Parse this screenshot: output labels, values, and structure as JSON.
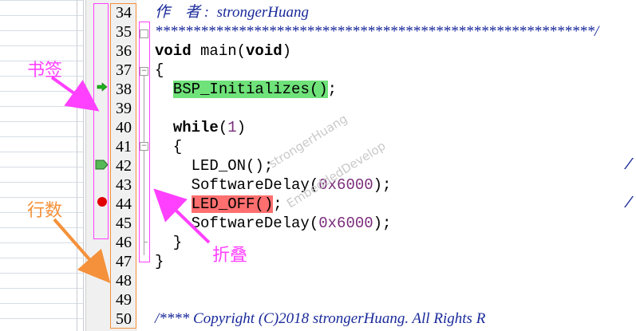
{
  "editor": {
    "line_numbers": [
      "34",
      "35",
      "36",
      "37",
      "38",
      "39",
      "40",
      "41",
      "42",
      "43",
      "44",
      "45",
      "46",
      "47",
      "48",
      "49",
      "50"
    ],
    "lines": [
      {
        "segments": [
          {
            "t": "作    者 :  strongerHuang",
            "c": "comment"
          }
        ]
      },
      {
        "segments": [
          {
            "t": "**********************************************************/",
            "c": "comment"
          }
        ]
      },
      {
        "segments": [
          {
            "t": "void",
            "c": "kw"
          },
          {
            "t": " main("
          },
          {
            "t": "void",
            "c": "kw"
          },
          {
            "t": ")"
          }
        ]
      },
      {
        "segments": [
          {
            "t": "{"
          }
        ]
      },
      {
        "segments": [
          {
            "t": "  "
          },
          {
            "t": "BSP_Initializes()",
            "c": "hl-green"
          },
          {
            "t": ";"
          }
        ]
      },
      {
        "segments": []
      },
      {
        "segments": [
          {
            "t": "  "
          },
          {
            "t": "while",
            "c": "kw"
          },
          {
            "t": "("
          },
          {
            "t": "1",
            "c": "num"
          },
          {
            "t": ")"
          }
        ]
      },
      {
        "segments": [
          {
            "t": "  {"
          }
        ]
      },
      {
        "segments": [
          {
            "t": "    LED_ON();"
          }
        ]
      },
      {
        "segments": [
          {
            "t": "    SoftwareDelay("
          },
          {
            "t": "0x6000",
            "c": "num"
          },
          {
            "t": ");"
          }
        ]
      },
      {
        "segments": [
          {
            "t": "    "
          },
          {
            "t": "LED_OFF()",
            "c": "hl-red"
          },
          {
            "t": ";"
          }
        ]
      },
      {
        "segments": [
          {
            "t": "    SoftwareDelay("
          },
          {
            "t": "0x6000",
            "c": "num"
          },
          {
            "t": ");"
          }
        ]
      },
      {
        "segments": [
          {
            "t": "  }"
          }
        ]
      },
      {
        "segments": [
          {
            "t": "}"
          }
        ]
      },
      {
        "segments": []
      },
      {
        "segments": []
      },
      {
        "segments": [
          {
            "t": "/**** Copyright (C)2018 strongerHuang. All Rights R",
            "c": "comment"
          }
        ]
      }
    ],
    "trailing_comment_marker": "/"
  },
  "annotations": {
    "bookmark_label": "书签",
    "line_number_label": "行数",
    "fold_label": "折叠"
  },
  "watermarks": [
    "strongerHuang",
    "EmbeddedDevelop"
  ],
  "colors": {
    "bookmark_annotation": "#ff40ff",
    "line_number_annotation": "#f4913a",
    "fold_annotation": "#ff40ff",
    "breakpoint": "#e00000",
    "current_line_arrow": "#20b020",
    "highlight_green": "#6fe27a",
    "highlight_red": "#ff6f6f"
  },
  "margin_icons": {
    "line_38": "current-line-arrow-icon",
    "line_42": "bookmark-flag-icon",
    "line_44": "breakpoint-icon"
  }
}
